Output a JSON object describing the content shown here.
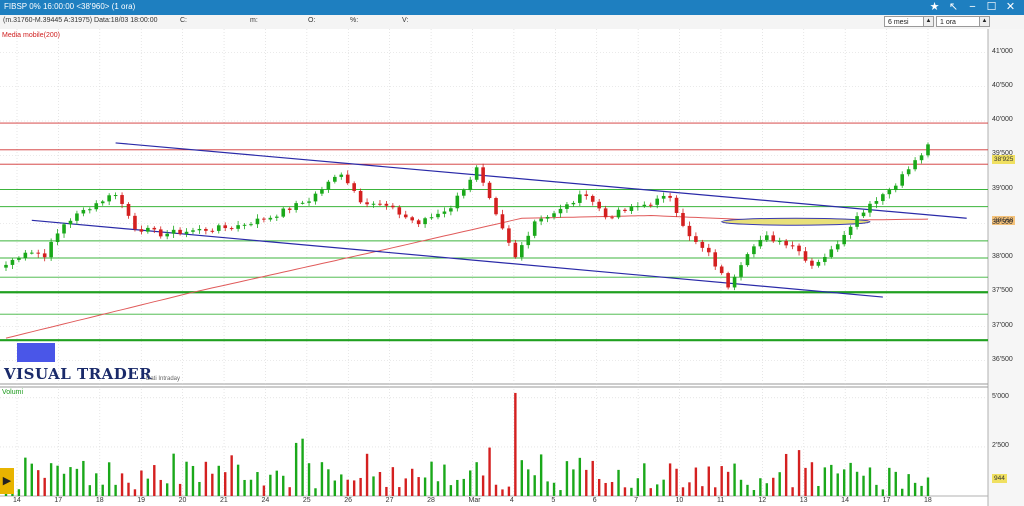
{
  "window": {
    "title": "FIBSP 0% 16:00:00 <38'960> (1 ora)",
    "icons": [
      "star-icon",
      "cursor-icon",
      "minimize-icon",
      "maximize-icon",
      "close-icon"
    ]
  },
  "infobar": {
    "ohlc": "(m.31760-M.39445 A:31975) Data:18/03 18:00:00",
    "c_label": "C:",
    "m_label": "m:",
    "o_label": "O:",
    "pct_label": "%:",
    "v_label": "V:",
    "period_select": "6 mesi",
    "interval_select": "1 ora"
  },
  "panels": {
    "indicator_label": "Media mobile(200)",
    "volume_label": "Volumi",
    "logo": "VISUAL TRADER",
    "logo_sub": "Dati Intraday"
  },
  "price_tags": {
    "last": "38'925",
    "ma": "38'568"
  },
  "colors": {
    "candle_up": "#1aa81a",
    "candle_down": "#d42020",
    "ma": "#e05a5a",
    "trendline": "#2a2aa8",
    "hline_green": "#3cb43c",
    "hline_red": "#d03030",
    "titlebar": "#1e7fc0"
  },
  "chart_data": [
    {
      "type": "candlestick",
      "title": "FIBSP",
      "y_ticks": [
        "41'000",
        "40'500",
        "40'000",
        "39'500",
        "39'000",
        "38'500",
        "38'000",
        "37'500",
        "37'000",
        "36'500"
      ],
      "y_tick_values": [
        41000,
        40500,
        40000,
        39500,
        39000,
        38500,
        38000,
        37500,
        37000,
        36500
      ],
      "ylim": [
        36200,
        41500
      ],
      "x_ticks": [
        "14",
        "17",
        "18",
        "19",
        "20",
        "21",
        "24",
        "25",
        "26",
        "27",
        "28",
        "Mar",
        "4",
        "5",
        "6",
        "7",
        "10",
        "11",
        "12",
        "13",
        "14",
        "17",
        "18"
      ],
      "close_anchors": [
        [
          0,
          37900
        ],
        [
          3,
          38100
        ],
        [
          6,
          38050
        ],
        [
          9,
          38500
        ],
        [
          13,
          38750
        ],
        [
          17,
          38950
        ],
        [
          20,
          38450
        ],
        [
          24,
          38350
        ],
        [
          29,
          38400
        ],
        [
          35,
          38450
        ],
        [
          41,
          38600
        ],
        [
          47,
          38850
        ],
        [
          52,
          39250
        ],
        [
          55,
          38850
        ],
        [
          59,
          38750
        ],
        [
          64,
          38500
        ],
        [
          69,
          38750
        ],
        [
          73,
          39300
        ],
        [
          76,
          38600
        ],
        [
          79,
          38000
        ],
        [
          82,
          38550
        ],
        [
          86,
          38700
        ],
        [
          90,
          38950
        ],
        [
          93,
          38600
        ],
        [
          98,
          38750
        ],
        [
          103,
          38900
        ],
        [
          106,
          38300
        ],
        [
          109,
          38050
        ],
        [
          112,
          37600
        ],
        [
          115,
          38100
        ],
        [
          118,
          38300
        ],
        [
          122,
          38200
        ],
        [
          125,
          37900
        ],
        [
          128,
          38100
        ],
        [
          131,
          38500
        ],
        [
          134,
          38800
        ],
        [
          137,
          39000
        ],
        [
          140,
          39300
        ],
        [
          143,
          39620
        ]
      ],
      "moving_average": [
        [
          0,
          36830
        ],
        [
          29,
          37500
        ],
        [
          60,
          38150
        ],
        [
          80,
          38580
        ],
        [
          100,
          38620
        ],
        [
          120,
          38540
        ],
        [
          143,
          38568
        ]
      ],
      "trendlines": [
        {
          "from": [
            17,
            39680
          ],
          "to": [
            149,
            38580
          ]
        },
        {
          "from": [
            4,
            38550
          ],
          "to": [
            136,
            37430
          ]
        }
      ],
      "horizontal_lines_green": [
        39000,
        38750,
        38250,
        38000,
        37720,
        37500,
        37180
      ],
      "horizontal_lines_red": [
        39970,
        39580,
        39370
      ],
      "thick_green_lines": [
        37500,
        36800
      ],
      "highlight_zone": {
        "from_x": 111,
        "to_x": 134,
        "y": 38530
      }
    },
    {
      "type": "bar",
      "title": "Volumi",
      "y_ticks": [
        "5'000",
        "2'500"
      ],
      "y_tick_values": [
        5000,
        2500
      ],
      "ylim": [
        0,
        5400
      ],
      "last_value": "944"
    }
  ]
}
